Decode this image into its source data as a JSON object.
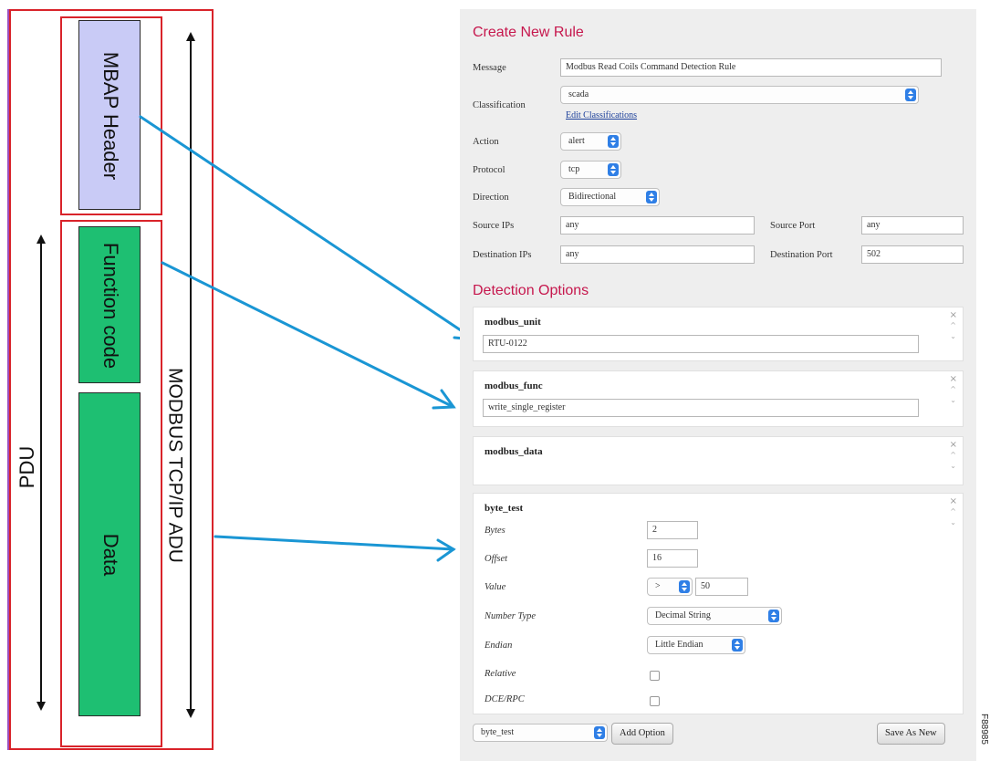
{
  "diagram": {
    "blocks": {
      "mbap": "MBAP Header",
      "function_code": "Function code",
      "data": "Data"
    },
    "labels": {
      "adu": "MODBUS TCP/IP ADU",
      "pdu": "PDU"
    },
    "colors": {
      "frame": "#d9232a",
      "mbap_fill": "#c9cbf6",
      "pdu_fill": "#1ebf72",
      "arrow": "#1a96d4"
    }
  },
  "form": {
    "create_title": "Create New Rule",
    "message_label": "Message",
    "message_value": "Modbus Read Coils Command Detection Rule",
    "classification_label": "Classification",
    "classification_value": "scada",
    "edit_classifications": "Edit Classifications",
    "action_label": "Action",
    "action_value": "alert",
    "protocol_label": "Protocol",
    "protocol_value": "tcp",
    "direction_label": "Direction",
    "direction_value": "Bidirectional",
    "source_ips_label": "Source IPs",
    "source_ips_value": "any",
    "source_port_label": "Source Port",
    "source_port_value": "any",
    "dest_ips_label": "Destination IPs",
    "dest_ips_value": "any",
    "dest_port_label": "Destination Port",
    "dest_port_value": "502",
    "detection_title": "Detection Options",
    "options": {
      "unit": {
        "title": "modbus_unit",
        "value": "RTU-0122"
      },
      "func": {
        "title": "modbus_func",
        "value": "write_single_register"
      },
      "data": {
        "title": "modbus_data"
      },
      "byte_test": {
        "title": "byte_test",
        "bytes_label": "Bytes",
        "bytes_value": "2",
        "offset_label": "Offset",
        "offset_value": "16",
        "value_label": "Value",
        "operator_value": ">",
        "value_value": "50",
        "number_type_label": "Number Type",
        "number_type_value": "Decimal String",
        "endian_label": "Endian",
        "endian_value": "Little Endian",
        "relative_label": "Relative",
        "dce_rpc_label": "DCE/RPC"
      }
    },
    "controls": {
      "remove": "×",
      "move_up": "^",
      "move_down": "⌄"
    },
    "option_select_value": "byte_test",
    "add_option_label": "Add Option",
    "save_as_new_label": "Save As New",
    "figure_id": "F88985"
  }
}
